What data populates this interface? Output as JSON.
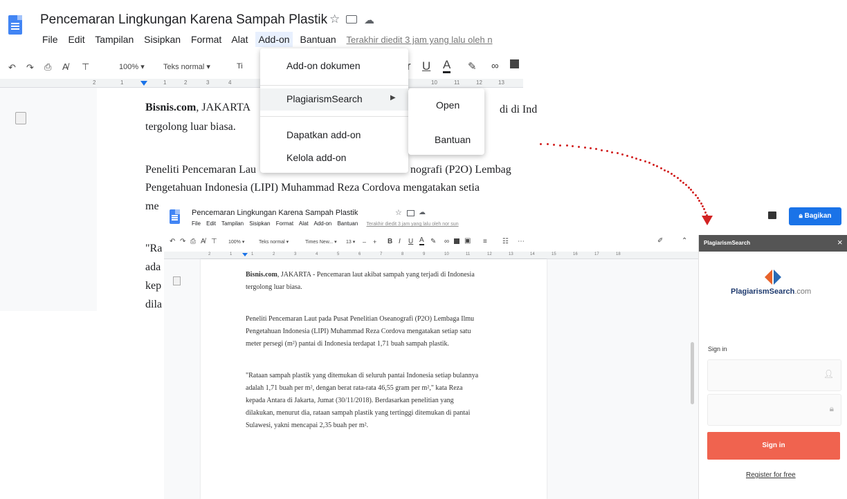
{
  "doc1": {
    "title": "Pencemaran Lingkungan Karena Sampah Plastik",
    "menu": [
      "File",
      "Edit",
      "Tampilan",
      "Sisipkan",
      "Format",
      "Alat",
      "Add-on",
      "Bantuan"
    ],
    "last_edit": "Terakhir diedit 3 jam yang lalu oleh n",
    "zoom": "100%",
    "style": "Teks normal",
    "ruler_numbers": [
      "2",
      "1",
      "1",
      "2",
      "3",
      "4",
      "10",
      "11",
      "12",
      "13"
    ],
    "addon_menu": {
      "items": [
        "Add-on dokumen",
        "PlagiarismSearch",
        "Dapatkan add-on",
        "Kelola add-on"
      ],
      "submenu": [
        "Open",
        "Bantuan"
      ]
    },
    "text": {
      "p1_bold": "Bisnis.com",
      "p1_a": ", JAKARTA",
      "p1_tail": "di di Ind",
      "p1_line2": "tergolong luar biasa.",
      "p2_line1a": "Peneliti Pencemaran Lau",
      "p2_line1b": "nografi (P2O) Lembag",
      "p2_line2": "Pengetahuan Indonesia (LIPI) Muhammad Reza Cordova mengatakan setia",
      "p2_line3": "me",
      "p3_frag": [
        "\"Ra",
        "ada",
        "kep",
        "dila"
      ]
    }
  },
  "doc2": {
    "title": "Pencemaran Lingkungan Karena Sampah Plastik",
    "menu": [
      "File",
      "Edit",
      "Tampilan",
      "Sisipkan",
      "Format",
      "Alat",
      "Add-on",
      "Bantuan"
    ],
    "last_edit": "Terakhir diedit 3 jam yang lalu oleh nor sun",
    "zoom": "100%",
    "style": "Teks normal",
    "font": "Times New...",
    "font_size": "13",
    "ruler_numbers": [
      "2",
      "1",
      "1",
      "2",
      "3",
      "4",
      "5",
      "6",
      "7",
      "8",
      "9",
      "10",
      "11",
      "12",
      "13",
      "14",
      "15",
      "16",
      "17",
      "18"
    ],
    "p1_bold": "Bisnis.com",
    "p1_rest": ", JAKARTA - Pencemaran laut akibat sampah yang terjadi di Indonesia",
    "p1_line2": "tergolong luar biasa.",
    "p2_line1": "Peneliti Pencemaran Laut pada Pusat Penelitian Oseanografi (P2O) Lembaga Ilmu",
    "p2_line2": "Pengetahuan Indonesia (LIPI) Muhammad Reza Cordova mengatakan setiap satu",
    "p2_line3": "meter persegi (m²) pantai di Indonesia terdapat 1,71 buah sampah plastik.",
    "p3_line1": "\"Rataan sampah plastik yang ditemukan di seluruh pantai Indonesia setiap bulannya",
    "p3_line2": "adalah 1,71 buah per m², dengan berat rata-rata 46,55 gram per m²,\" kata Reza",
    "p3_line3": "kepada Antara di Jakarta, Jumat (30/11/2018). Berdasarkan penelitian yang",
    "p3_line4": "dilakukan, menurut dia, rataan sampah plastik yang tertinggi ditemukan di pantai",
    "p3_line5": "Sulawesi, yakni mencapai 2,35 buah per m²."
  },
  "share_button": "Bagikan",
  "sidebar": {
    "header": "PlagiarismSearch",
    "close": "×",
    "logo_main": "PlagiarismSearch",
    "logo_suffix": ".com",
    "signin_label": "Sign in",
    "signin_button": "Sign in",
    "register": "Register for free"
  },
  "colors": {
    "docs_blue": "#4285f4",
    "share_blue": "#1a73e8",
    "signin_red": "#f0634f",
    "arrow_red": "#d22222",
    "sidebar_header": "#555555"
  }
}
